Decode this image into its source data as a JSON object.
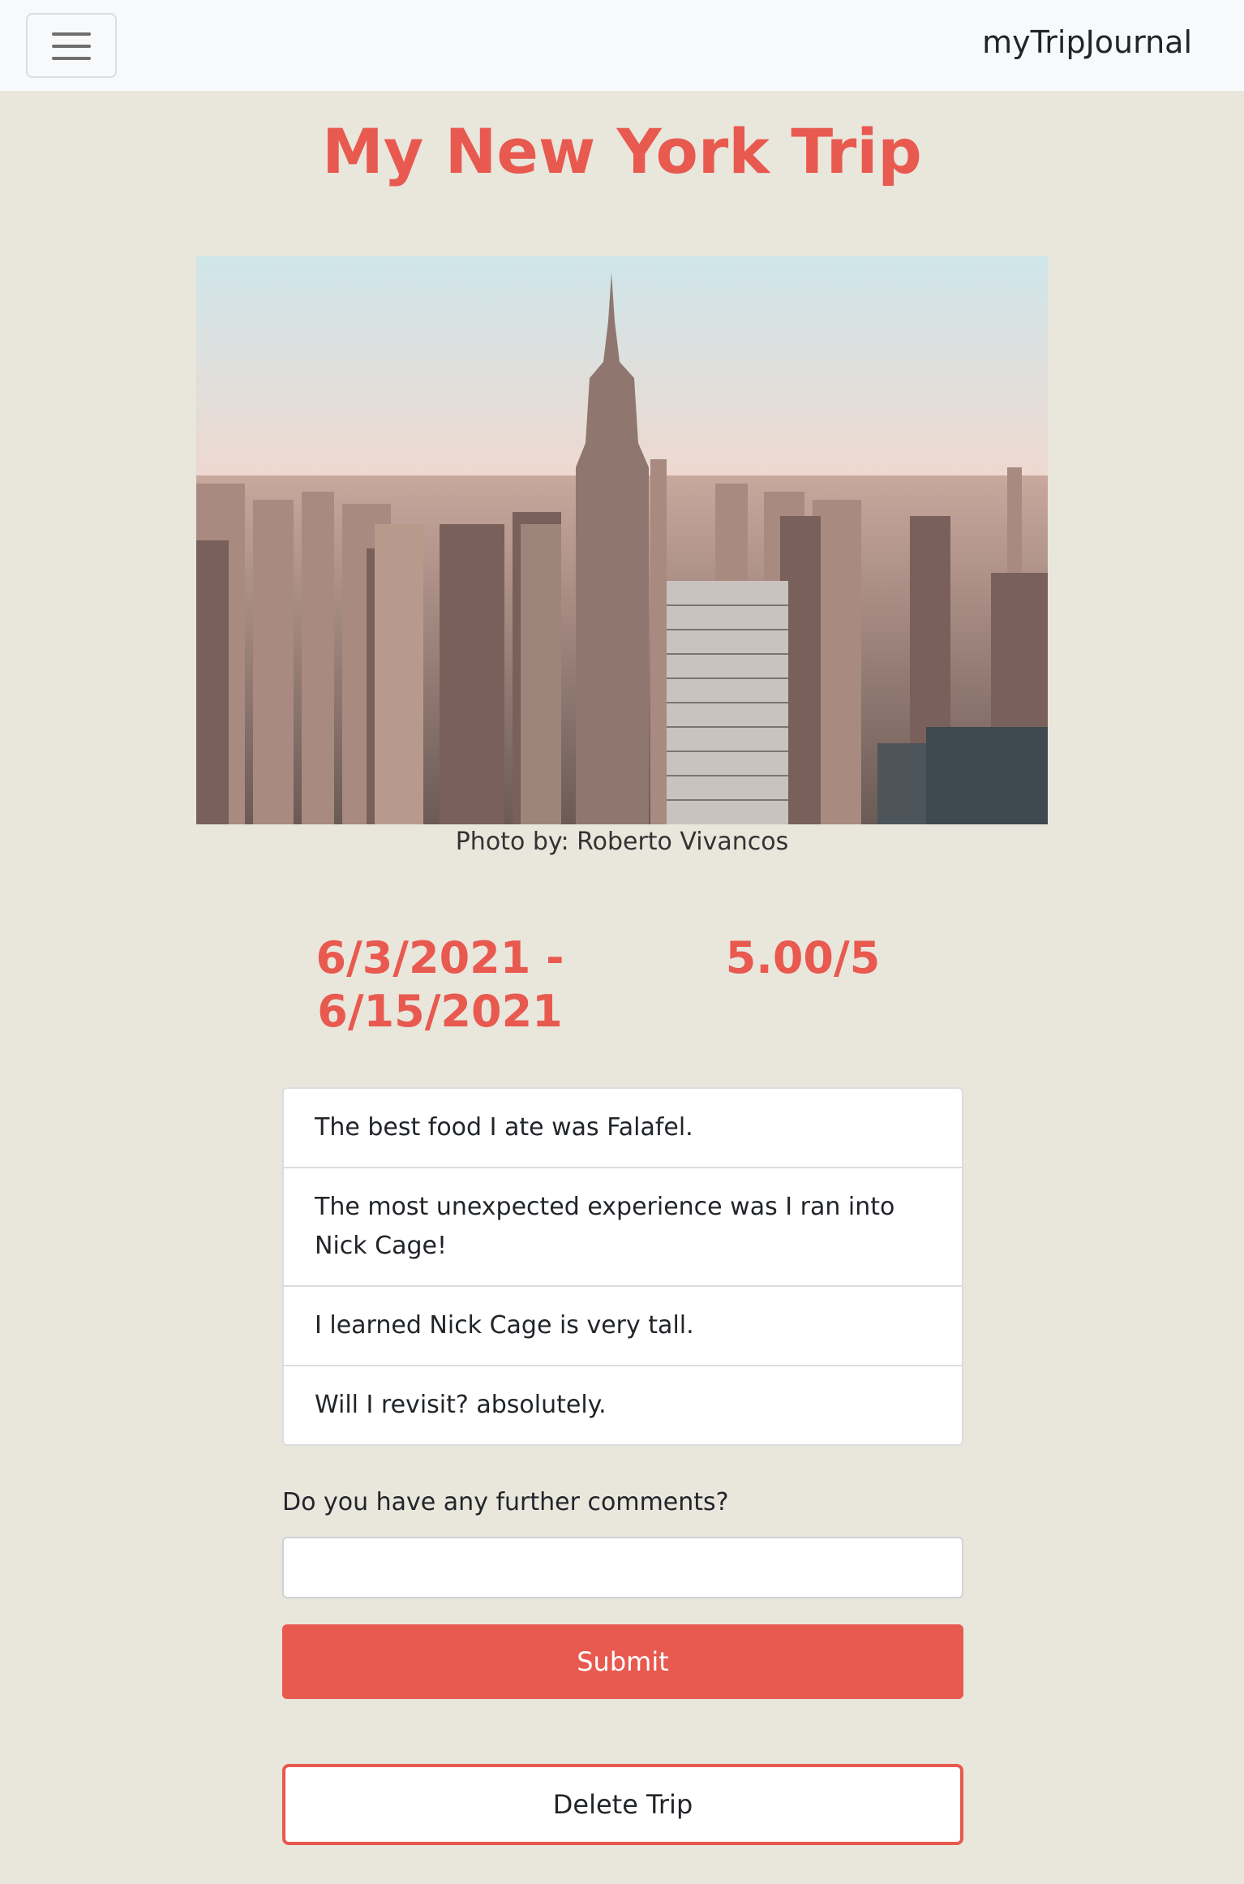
{
  "navbar": {
    "toggler_icon": "hamburger-menu-icon",
    "brand": "myTripJournal"
  },
  "trip": {
    "title": "My New York Trip",
    "photo_caption": "Photo by: Roberto Vivancos",
    "dates": "6/3/2021 - 6/15/2021",
    "rating": "5.00/5",
    "answers": [
      "The best food I ate was Falafel.",
      "The most unexpected experience was I ran into Nick Cage!",
      "I learned Nick Cage is very tall.",
      "Will I revisit? absolutely."
    ]
  },
  "comments": {
    "label": "Do you have any further comments?",
    "value": "",
    "submit_label": "Submit"
  },
  "actions": {
    "delete_label": "Delete Trip"
  },
  "colors": {
    "accent": "#e8594f",
    "page_background": "#e9e6dc",
    "navbar_background": "#f8f9fa"
  }
}
